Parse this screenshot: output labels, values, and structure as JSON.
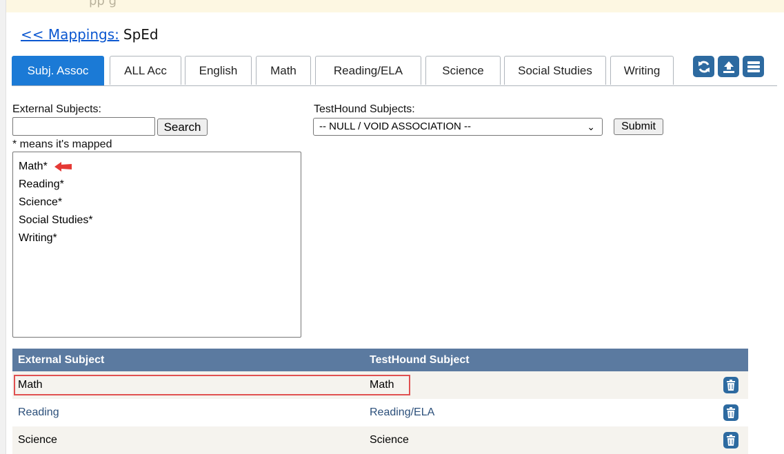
{
  "header": {
    "banner_text": "pp g",
    "back_link": "<< Mappings:",
    "current": "SpEd"
  },
  "tabs": [
    {
      "label": "Subj. Assoc",
      "active": true
    },
    {
      "label": "ALL Acc",
      "active": false
    },
    {
      "label": "English",
      "active": false
    },
    {
      "label": "Math",
      "active": false
    },
    {
      "label": "Reading/ELA",
      "active": false
    },
    {
      "label": "Science",
      "active": false
    },
    {
      "label": "Social Studies",
      "active": false
    },
    {
      "label": "Writing",
      "active": false
    }
  ],
  "toolbar": {
    "icons": [
      "refresh-icon",
      "upload-icon",
      "menu-icon"
    ],
    "accent_color": "#2d6aa0"
  },
  "external": {
    "label": "External Subjects:",
    "search_value": "",
    "search_button": "Search",
    "mapped_note": "* means it's mapped",
    "items": [
      "Math*",
      "Reading*",
      "Science*",
      "Social Studies*",
      "Writing*"
    ]
  },
  "testhound": {
    "label": "TestHound Subjects:",
    "selected": "-- NULL / VOID ASSOCIATION --",
    "submit_button": "Submit"
  },
  "grid": {
    "headers": [
      "External Subject",
      "TestHound Subject"
    ],
    "rows": [
      {
        "external": "Math",
        "testhound": "Math"
      },
      {
        "external": "Reading",
        "testhound": "Reading/ELA"
      },
      {
        "external": "Science",
        "testhound": "Science"
      }
    ]
  }
}
